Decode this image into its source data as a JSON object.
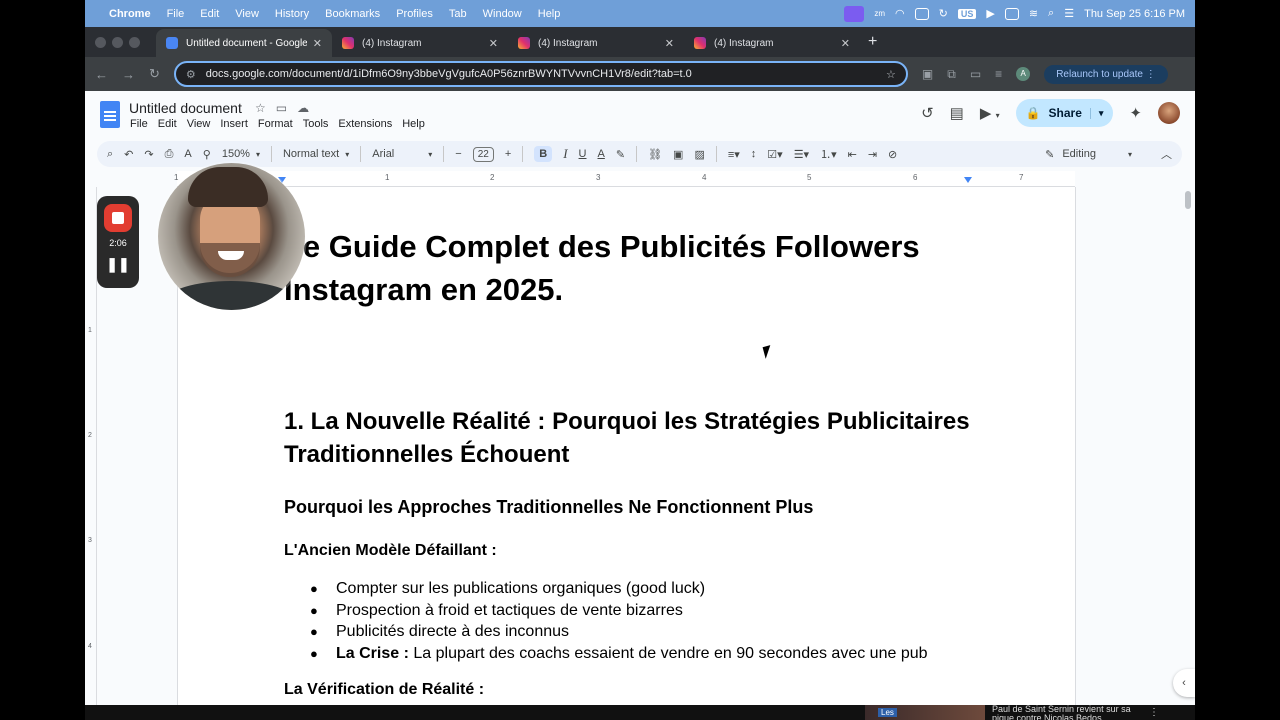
{
  "menubar": {
    "app": "Chrome",
    "items": [
      "File",
      "Edit",
      "View",
      "History",
      "Bookmarks",
      "Profiles",
      "Tab",
      "Window",
      "Help"
    ],
    "keyboard": "US",
    "clock": "Thu Sep 25  6:16 PM",
    "zoom_badge": "zm"
  },
  "tabs": [
    {
      "title": "Untitled document - Google Docs",
      "icon": "docs-icon",
      "active": true
    },
    {
      "title": "(4) Instagram",
      "icon": "instagram-icon",
      "active": false
    },
    {
      "title": "(4) Instagram",
      "icon": "instagram-icon",
      "active": false
    },
    {
      "title": "(4) Instagram",
      "icon": "instagram-icon",
      "active": false
    }
  ],
  "address_bar": {
    "url": "docs.google.com/document/d/1iDfm6O9ny3bbeVgVgufcA0P56znrBWYNTVvvnCH1Vr8/edit?tab=t.0",
    "profile_initial": "A",
    "relaunch_label": "Relaunch to update"
  },
  "docs": {
    "title": "Untitled document",
    "menu": [
      "File",
      "Edit",
      "View",
      "Insert",
      "Format",
      "Tools",
      "Extensions",
      "Help"
    ],
    "share_label": "Share",
    "toolbar": {
      "zoom": "150%",
      "style": "Normal text",
      "font": "Arial",
      "font_size": "22",
      "mode": "Editing"
    }
  },
  "ruler": {
    "numbers": [
      "1",
      "1",
      "2",
      "3",
      "4",
      "5",
      "6",
      "7"
    ]
  },
  "vruler": {
    "numbers": [
      "1",
      "2",
      "3",
      "4"
    ]
  },
  "document": {
    "title": "Le Guide Complet des Publicités Followers Instagram en 2025.",
    "h1": "1. La Nouvelle Réalité : Pourquoi les Stratégies Publicitaires Traditionnelles Échouent",
    "h2": "Pourquoi les Approches Traditionnelles Ne Fonctionnent Plus",
    "h3": "L'Ancien Modèle Défaillant :",
    "bullets": [
      "Compter sur les publications organiques (good luck)",
      "Prospection à froid et tactiques de vente bizarres",
      "Publicités directe à des inconnus"
    ],
    "last_bullet_bold": "La Crise :",
    "last_bullet_text": " La plupart des coachs essaient de vendre en 90 secondes avec une pub",
    "h3_last": "La Vérification de Réalité :"
  },
  "recorder": {
    "time": "2:06"
  },
  "bottom_strip": {
    "badge": "Les",
    "news": "Paul de Saint Sernin revient sur sa pique contre Nicolas Bedos"
  },
  "colors": {
    "menubar": "#6f9fd8",
    "chrome_bg": "#2b2e33",
    "omnibox_focus": "#7ab4f8",
    "share_bg": "#c2e7ff",
    "toolbar_bg": "#edf2fa",
    "record_red": "#e23d31"
  }
}
